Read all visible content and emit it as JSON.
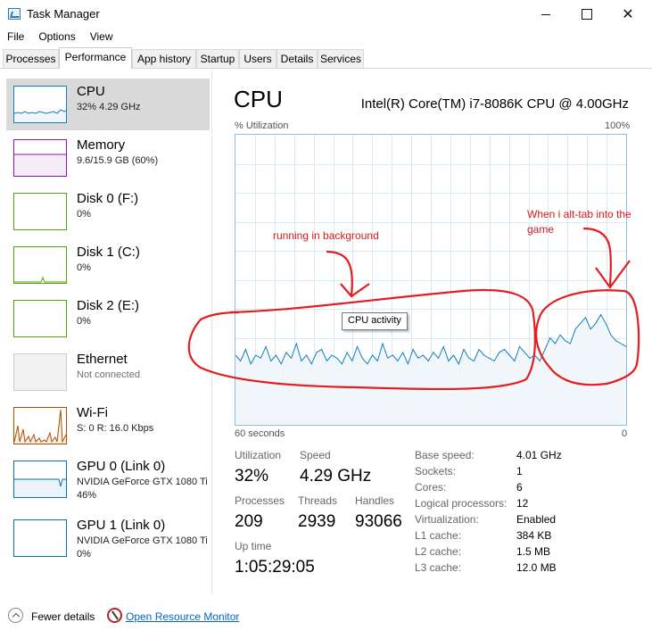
{
  "window": {
    "title": "Task Manager",
    "minimize_icon": "minimize-icon",
    "maximize_icon": "maximize-icon",
    "close_symbol": "✕"
  },
  "menu": [
    "File",
    "Options",
    "View"
  ],
  "tabs": [
    {
      "label": "Processes",
      "active": false
    },
    {
      "label": "Performance",
      "active": true
    },
    {
      "label": "App history",
      "active": false
    },
    {
      "label": "Startup",
      "active": false
    },
    {
      "label": "Users",
      "active": false
    },
    {
      "label": "Details",
      "active": false
    },
    {
      "label": "Services",
      "active": false
    }
  ],
  "sidebar": {
    "items": [
      {
        "name": "CPU",
        "line1": "32%  4.29 GHz",
        "line2": "",
        "color": "#117dbb",
        "selected": true
      },
      {
        "name": "Memory",
        "line1": "9.6/15.9 GB (60%)",
        "line2": "",
        "color": "#8b12ae",
        "selected": false
      },
      {
        "name": "Disk 0 (F:)",
        "line1": "0%",
        "line2": "",
        "color": "#4da60c",
        "selected": false
      },
      {
        "name": "Disk 1 (C:)",
        "line1": "0%",
        "line2": "",
        "color": "#4da60c",
        "selected": false
      },
      {
        "name": "Disk 2 (E:)",
        "line1": "0%",
        "line2": "",
        "color": "#4da60c",
        "selected": false
      },
      {
        "name": "Ethernet",
        "line1": "Not connected",
        "line2": "",
        "color": "#cccccc",
        "selected": false
      },
      {
        "name": "Wi-Fi",
        "line1": "S: 0  R: 16.0 Kbps",
        "line2": "",
        "color": "#a74f01",
        "selected": false
      },
      {
        "name": "GPU 0 (Link 0)",
        "line1": "NVIDIA GeForce GTX 1080 Ti",
        "line2": "46%",
        "color": "#0b6fa8",
        "selected": false
      },
      {
        "name": "GPU 1 (Link 0)",
        "line1": "NVIDIA GeForce GTX 1080 Ti",
        "line2": "0%",
        "color": "#0b6fa8",
        "selected": false
      }
    ]
  },
  "cpu": {
    "heading": "CPU",
    "model": "Intel(R) Core(TM) i7-8086K CPU @ 4.00GHz",
    "graph": {
      "y_label": "% Utilization",
      "y_max_label": "100%",
      "x_left_label": "60 seconds",
      "x_right_label": "0",
      "line_color": "#117dbb",
      "fill_color": "#f1f6fa",
      "grid_color": "#d9eaf7",
      "utilization_series": [
        24,
        22,
        26,
        21,
        24,
        23,
        27,
        22,
        24,
        21,
        25,
        23,
        28,
        22,
        24,
        21,
        25,
        26,
        22,
        24,
        23,
        21,
        25,
        22,
        27,
        23,
        21,
        24,
        22,
        28,
        23,
        24,
        22,
        25,
        21,
        26,
        23,
        24,
        22,
        25,
        23,
        27,
        22,
        24,
        21,
        26,
        23,
        22,
        26,
        24,
        23,
        22,
        25,
        26,
        24,
        22,
        27,
        25,
        23,
        24,
        22,
        26,
        30,
        28,
        31,
        29,
        28,
        33,
        35,
        37,
        33,
        35,
        38,
        35,
        31,
        29,
        28,
        27
      ],
      "tooltip": "CPU activity"
    },
    "stats": {
      "utilization_label": "Utilization",
      "utilization": "32%",
      "speed_label": "Speed",
      "speed": "4.29 GHz",
      "processes_label": "Processes",
      "processes": "209",
      "threads_label": "Threads",
      "threads": "2939",
      "handles_label": "Handles",
      "handles": "93066",
      "uptime_label": "Up time",
      "uptime": "1:05:29:05"
    },
    "specs": [
      {
        "label": "Base speed:",
        "value": "4.01 GHz"
      },
      {
        "label": "Sockets:",
        "value": "1"
      },
      {
        "label": "Cores:",
        "value": "6"
      },
      {
        "label": "Logical processors:",
        "value": "12"
      },
      {
        "label": "Virtualization:",
        "value": "Enabled"
      },
      {
        "label": "L1 cache:",
        "value": "384 KB"
      },
      {
        "label": "L2 cache:",
        "value": "1.5 MB"
      },
      {
        "label": "L3 cache:",
        "value": "12.0 MB"
      }
    ]
  },
  "annotations": {
    "background": "running in background",
    "alttab_line1": "When i alt-tab into the",
    "alttab_line2": "game",
    "color": "#d41b1b"
  },
  "footer": {
    "fewer_details": "Fewer details",
    "open_monitor": "Open Resource Monitor"
  }
}
